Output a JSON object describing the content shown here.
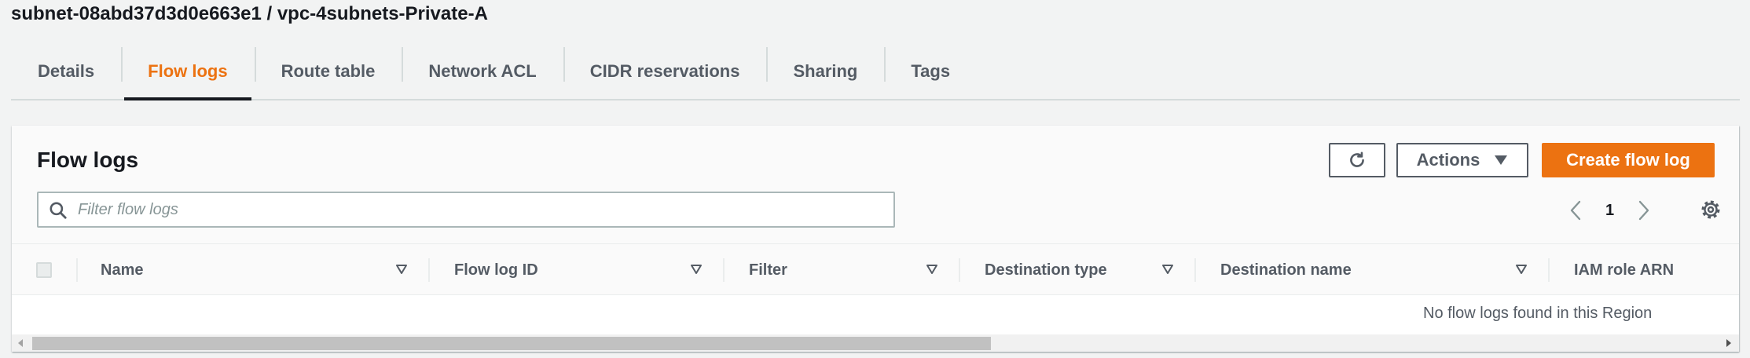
{
  "breadcrumb": "subnet-08abd37d3d0e663e1 / vpc-4subnets-Private-A",
  "tabs": [
    {
      "label": "Details",
      "active": false
    },
    {
      "label": "Flow logs",
      "active": true
    },
    {
      "label": "Route table",
      "active": false
    },
    {
      "label": "Network ACL",
      "active": false
    },
    {
      "label": "CIDR reservations",
      "active": false
    },
    {
      "label": "Sharing",
      "active": false
    },
    {
      "label": "Tags",
      "active": false
    }
  ],
  "panel": {
    "title": "Flow logs",
    "actions_label": "Actions",
    "create_label": "Create flow log",
    "search_placeholder": "Filter flow logs",
    "search_value": "",
    "page_number": "1"
  },
  "table": {
    "columns": [
      "Name",
      "Flow log ID",
      "Filter",
      "Destination type",
      "Destination name",
      "IAM role ARN"
    ],
    "rows": [],
    "empty_message": "No flow logs found in this Region"
  },
  "colors": {
    "accent": "#ec7211",
    "text": "#16191f",
    "secondary_text": "#545b64",
    "background": "#f2f3f3"
  },
  "icons": {
    "refresh": "refresh-icon",
    "actions_dropdown": "caret-down-icon",
    "search": "search-icon",
    "prev_page": "chevron-left-icon",
    "next_page": "chevron-right-icon",
    "settings": "gear-icon",
    "column_sort": "sort-caret-icon"
  }
}
